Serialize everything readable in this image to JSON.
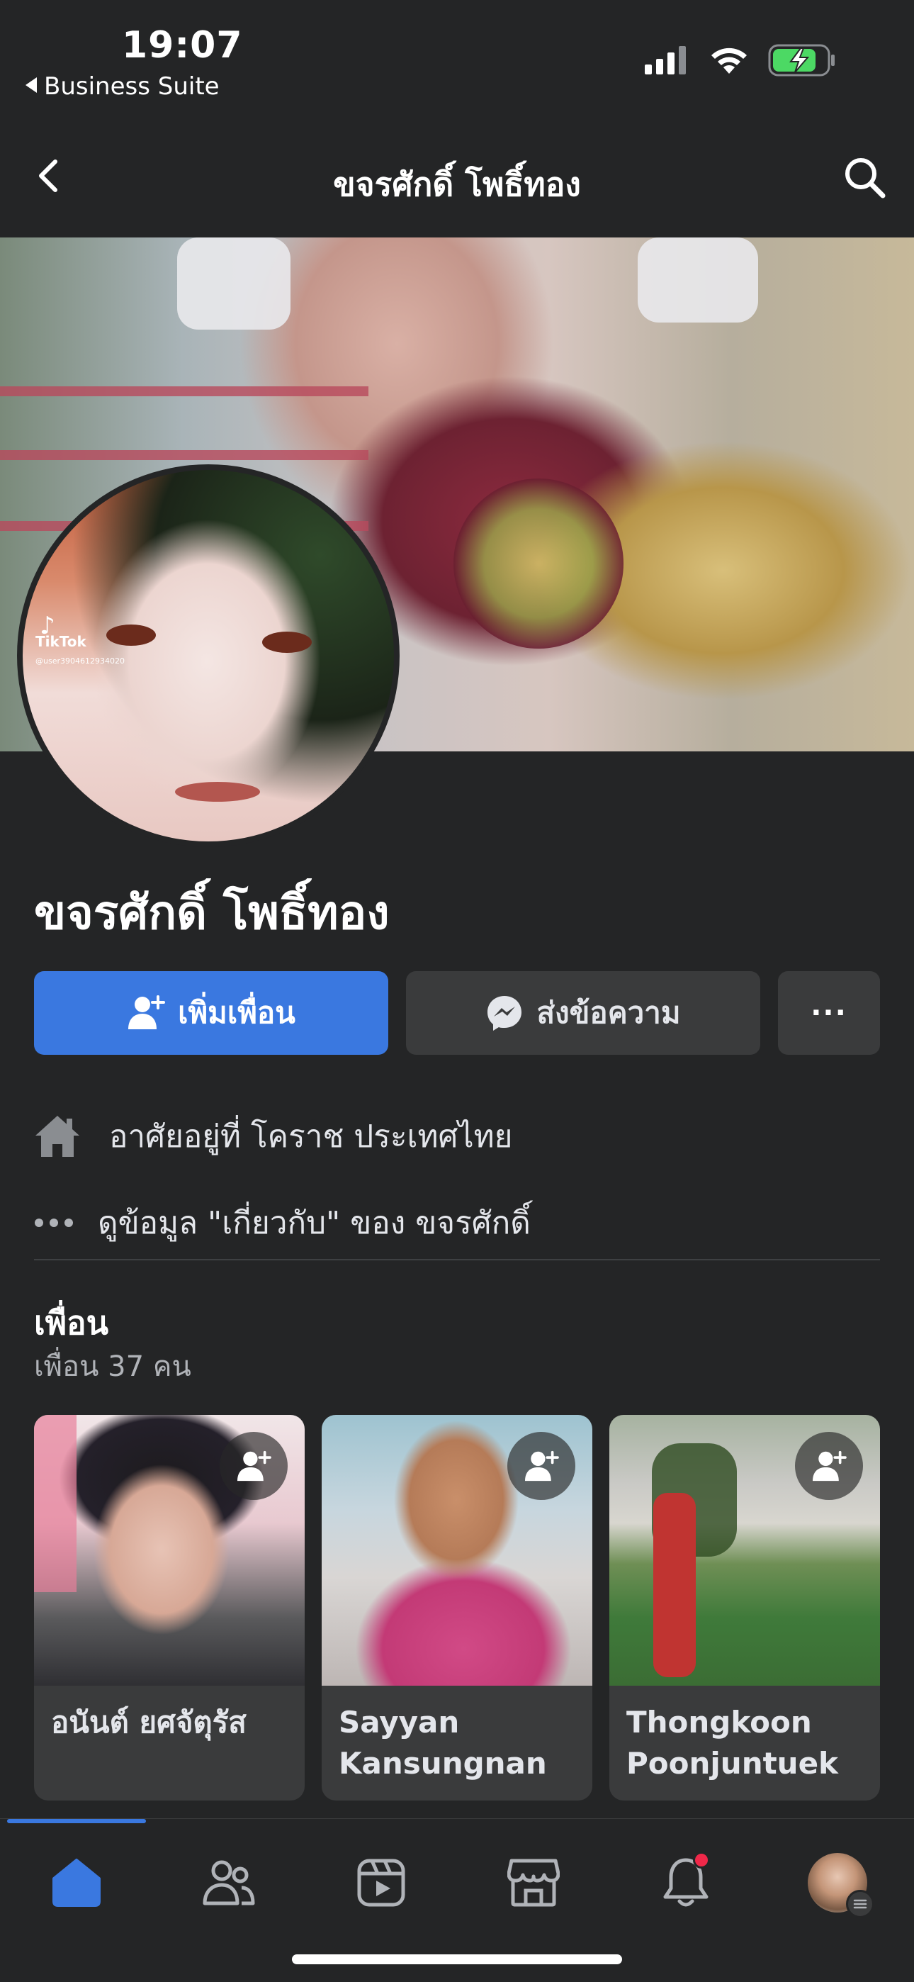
{
  "status_bar": {
    "time": "19:07",
    "back_app": "Business Suite",
    "battery_color": "#4cd964"
  },
  "nav": {
    "title": "ขจรศักดิ์ โพธิ์ทอง",
    "back_icon": "chevron-left-icon",
    "search_icon": "search-icon"
  },
  "cover": {
    "watermark_brand": "TikTok",
    "watermark_user": "@user3904612934020"
  },
  "profile": {
    "name": "ขจรศักดิ์ โพธิ์ทอง"
  },
  "actions": {
    "add_friend": "เพิ่มเพื่อน",
    "message": "ส่งข้อความ",
    "more": "···",
    "accent": "#3a78e0"
  },
  "info": {
    "lives_in": "อาศัยอยู่ที่ โคราช ประเทศไทย",
    "about": "ดูข้อมูล \"เกี่ยวกับ\" ของ ขจรศักดิ์"
  },
  "friends": {
    "title": "เพื่อน",
    "count": "เพื่อน 37 คน",
    "items": [
      {
        "name": "อนันต์ ยศจัตุรัส"
      },
      {
        "name": "Sayyan Kansungnan"
      },
      {
        "name": "Thongkoon Poonjuntuek"
      }
    ]
  },
  "tabbar": {
    "items": [
      "home-icon",
      "friends-icon",
      "video-icon",
      "marketplace-icon",
      "notifications-icon",
      "profile-avatar"
    ],
    "active": "home-icon",
    "notification_dot_color": "#f02849"
  }
}
